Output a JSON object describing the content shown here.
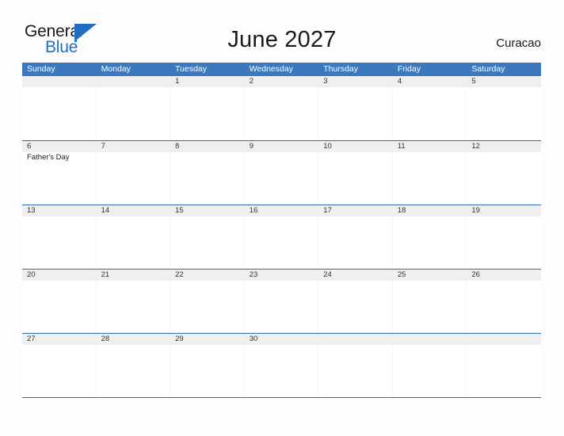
{
  "brand": {
    "word_one": "General",
    "word_two": "Blue",
    "accent_color": "#1f6fc4",
    "flag_icon": "triangle-flag-icon"
  },
  "header": {
    "title": "June 2027",
    "locale": "Curacao"
  },
  "calendar": {
    "month": "June",
    "year": "2027",
    "header_bg": "#3b78bd",
    "header_text_color": "#ffffff",
    "date_band_bg": "#efefef",
    "weekdays": [
      "Sunday",
      "Monday",
      "Tuesday",
      "Wednesday",
      "Thursday",
      "Friday",
      "Saturday"
    ],
    "weeks": [
      {
        "days": [
          {
            "num": "",
            "events": []
          },
          {
            "num": "",
            "events": []
          },
          {
            "num": "1",
            "events": []
          },
          {
            "num": "2",
            "events": []
          },
          {
            "num": "3",
            "events": []
          },
          {
            "num": "4",
            "events": []
          },
          {
            "num": "5",
            "events": []
          }
        ]
      },
      {
        "days": [
          {
            "num": "6",
            "events": [
              "Father's Day"
            ]
          },
          {
            "num": "7",
            "events": []
          },
          {
            "num": "8",
            "events": []
          },
          {
            "num": "9",
            "events": []
          },
          {
            "num": "10",
            "events": []
          },
          {
            "num": "11",
            "events": []
          },
          {
            "num": "12",
            "events": []
          }
        ]
      },
      {
        "days": [
          {
            "num": "13",
            "events": []
          },
          {
            "num": "14",
            "events": []
          },
          {
            "num": "15",
            "events": []
          },
          {
            "num": "16",
            "events": []
          },
          {
            "num": "17",
            "events": []
          },
          {
            "num": "18",
            "events": []
          },
          {
            "num": "19",
            "events": []
          }
        ]
      },
      {
        "days": [
          {
            "num": "20",
            "events": []
          },
          {
            "num": "21",
            "events": []
          },
          {
            "num": "22",
            "events": []
          },
          {
            "num": "23",
            "events": []
          },
          {
            "num": "24",
            "events": []
          },
          {
            "num": "25",
            "events": []
          },
          {
            "num": "26",
            "events": []
          }
        ]
      },
      {
        "days": [
          {
            "num": "27",
            "events": []
          },
          {
            "num": "28",
            "events": []
          },
          {
            "num": "29",
            "events": []
          },
          {
            "num": "30",
            "events": []
          },
          {
            "num": "",
            "events": []
          },
          {
            "num": "",
            "events": []
          },
          {
            "num": "",
            "events": []
          }
        ]
      }
    ]
  }
}
